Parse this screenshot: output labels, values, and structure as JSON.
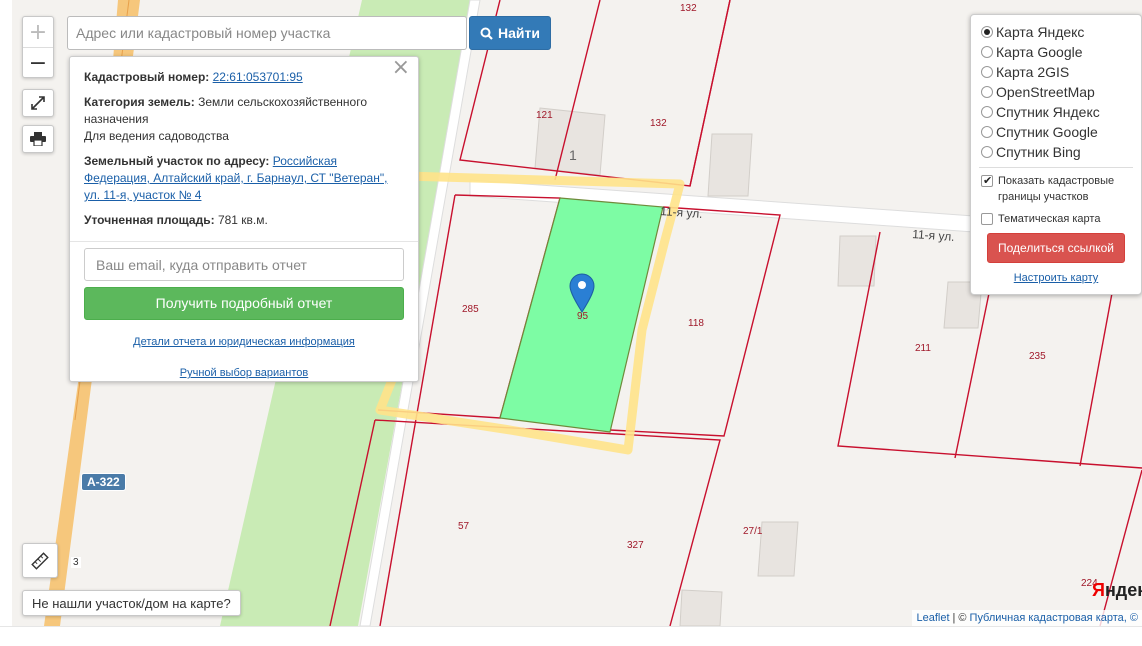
{
  "search": {
    "placeholder": "Адрес или кадастровый номер участка",
    "button_label": "Найти"
  },
  "zoom": {
    "plus": "+",
    "minus": "−"
  },
  "info": {
    "cadastral_label": "Кадастровый номер:",
    "cadastral_value": "22:61:053701:95",
    "category_label": "Категория земель:",
    "category_value": "Земли сельскохозяйственного назначения",
    "usage_value": "Для ведения садоводства",
    "address_label": "Земельный участок по адресу:",
    "address_value": "Российская Федерация, Алтайский край, г. Барнаул, СТ \"Ветеран\", ул. 11-я, участок № 4",
    "area_label": "Уточненная площадь:",
    "area_value": "781 кв.м.",
    "email_placeholder": "Ваш email, куда отправить отчет",
    "report_button": "Получить подробный отчет",
    "details_link": "Детали отчета и юридическая информация",
    "manual_link": "Ручной выбор вариантов",
    "close": "×"
  },
  "layers": {
    "options": [
      {
        "label": "Карта Яндекс",
        "selected": true
      },
      {
        "label": "Карта Google",
        "selected": false
      },
      {
        "label": "Карта 2GIS",
        "selected": false
      },
      {
        "label": "OpenStreetMap",
        "selected": false
      },
      {
        "label": "Спутник Яндекс",
        "selected": false
      },
      {
        "label": "Спутник Google",
        "selected": false
      },
      {
        "label": "Спутник Bing",
        "selected": false
      }
    ],
    "show_borders_label": "Показать кадастровые границы участков",
    "show_borders_checked": true,
    "thematic_label": "Тематическая карта",
    "thematic_checked": false,
    "share_button": "Поделиться ссылкой",
    "configure_link": "Настроить карту"
  },
  "map": {
    "plot_labels": [
      "132",
      "121",
      "132",
      "1",
      "285",
      "95",
      "118",
      "211",
      "235",
      "57",
      "327",
      "27/1",
      "224"
    ],
    "street_labels": [
      "11-я ул.",
      "11-я ул."
    ],
    "route_badge": "А-322",
    "road_number": "3",
    "colors": {
      "selected_plot": "#7dfca4",
      "plot_border": "#c8102e",
      "highlight": "#ffe38a",
      "green_strip": "#c9ebb5",
      "road": "#f6c77c"
    }
  },
  "controls": {
    "not_found": "Не нашли участок/дом на карте?"
  },
  "attribution": {
    "leaflet": "Leaflet",
    "sep": "| ©",
    "source": "Публичная кадастровая карта, ©"
  },
  "logo": {
    "first": "Я",
    "rest": "ндекс"
  }
}
